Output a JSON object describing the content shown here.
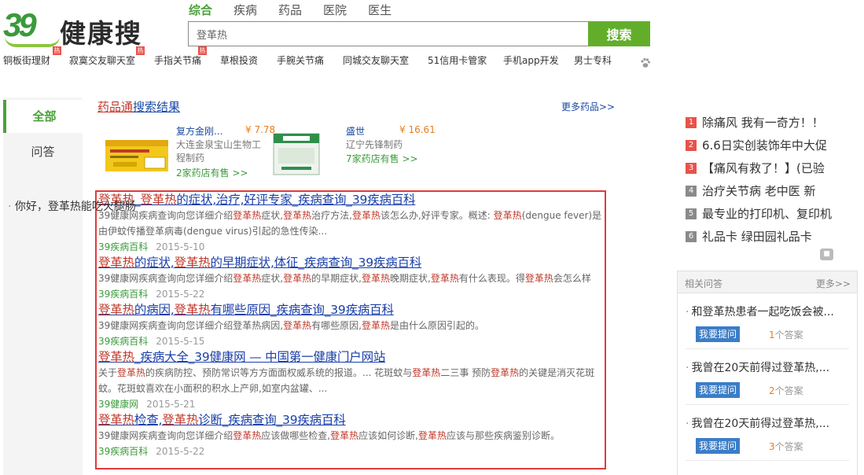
{
  "header": {
    "logo_number": "39",
    "logo_text": "健康搜",
    "tabs": [
      "综合",
      "疾病",
      "药品",
      "医院",
      "医生"
    ],
    "search_value": "登革热",
    "search_button": "搜索",
    "hotlinks": [
      "铜板街理财",
      "寂寞交友聊天室",
      "手指关节痛",
      "草根投资",
      "手腕关节痛",
      "同城交友聊天室",
      "51信用卡管家",
      "手机app开发",
      "男士专科"
    ],
    "hot_badge": "热"
  },
  "leftnav": {
    "items": [
      "全部",
      "问答"
    ]
  },
  "drugs": {
    "title_brand": "药品通",
    "title_rest": "搜索结果",
    "more": "更多药品>>",
    "cards": [
      {
        "name": "复方金刚...",
        "price": "¥ 7.78",
        "maker_line1": "大连金泉宝山生物工",
        "maker_line2": "程制药",
        "stores": "2家药店有售 >>"
      },
      {
        "name": "盛世",
        "price": "¥ 16.61",
        "maker_line1": "辽宁先锋制药",
        "maker_line2": "",
        "stores": "7家药店有售 >>"
      }
    ]
  },
  "results": [
    {
      "title": [
        "登革热",
        "_",
        "登革热",
        "的症状,治疗,好评专家_疾病查询_39疾病百科"
      ],
      "snippet_lines": [
        [
          "39健康网疾病查询向您详细介绍",
          "登革热",
          "症状,",
          "登革热",
          "治疗方法,",
          "登革热",
          "该怎么办,好评专家。概述: ",
          "登革热",
          "(dengue fever)是"
        ],
        [
          "由伊蚊传播登革病毒(dengue virus)引起的急性传染..."
        ]
      ],
      "source": "39疾病百科",
      "date": "2015-5-10"
    },
    {
      "title": [
        "登革热",
        "的症状,",
        "登革热",
        "的早期症状,体征_疾病查询_39疾病百科"
      ],
      "snippet_lines": [
        [
          "39健康网疾病查询向您详细介绍",
          "登革热",
          "症状,",
          "登革热",
          "的早期症状,",
          "登革热",
          "晚期症状,",
          "登革热",
          "有什么表现。得",
          "登革热",
          "会怎么样"
        ]
      ],
      "source": "39疾病百科",
      "date": "2015-5-22"
    },
    {
      "title": [
        "登革热",
        "的病因,",
        "登革热",
        "有哪些原因_疾病查询_39疾病百科"
      ],
      "snippet_lines": [
        [
          "39健康网疾病查询向您详细介绍登革热病因,",
          "登革热",
          "有哪些原因,",
          "登革热",
          "是由什么原因引起的。"
        ]
      ],
      "source": "39疾病百科",
      "date": "2015-5-15"
    },
    {
      "title": [
        "登革热",
        "_疾病大全_39健康网 — 中国第一健康门户网站"
      ],
      "snippet_lines": [
        [
          "关于",
          "登革热",
          "的疾病防控、预防常识等方方面面权威系统的报道。... 花斑蚊与",
          "登革热",
          "二三事 预防",
          "登革热",
          "的关键是消灭花斑"
        ],
        [
          "蚊。花斑蚊喜欢在小面积的积水上产卵,如室内盆罐、..."
        ]
      ],
      "source": "39健康网",
      "date": "2015-5-21"
    },
    {
      "title": [
        "登革热",
        "检查,",
        "登革热",
        "诊断_疾病查询_39疾病百科"
      ],
      "snippet_lines": [
        [
          "39健康网疾病查询向您详细介绍",
          "登革热",
          "应该做哪些检查,",
          "登革热",
          "应该如何诊断,",
          "登革热",
          "应该与那些疾病鉴别诊断。"
        ]
      ],
      "source": "39疾病百科",
      "date": "2015-5-22"
    }
  ],
  "ranking": [
    {
      "num": "1",
      "text": "除痛风 我有一奇方！！"
    },
    {
      "num": "2",
      "text": "6.6日实创装饰年中大促"
    },
    {
      "num": "3",
      "text": "【痛风有救了！】(已验"
    },
    {
      "num": "4",
      "text": "治疗关节病 老中医 新"
    },
    {
      "num": "5",
      "text": "最专业的打印机、复印机"
    },
    {
      "num": "6",
      "text": "礼品卡 绿田园礼品卡"
    }
  ],
  "qa": {
    "title": "相关问答",
    "more": "更多>>",
    "ask_label": "我要提问",
    "answer_suffix": "个答案",
    "items": [
      {
        "q": "和登革热患者一起吃饭会被...",
        "count": "1"
      },
      {
        "q": "我曾在20天前得过登革热,...",
        "count": "2"
      },
      {
        "q": "我曾在20天前得过登革热,...",
        "count": "3"
      }
    ],
    "partial": "你好，登革热能吃火腿肠"
  },
  "colors": {
    "accent_green": "#62ae2a",
    "link_blue": "#1a3fa8",
    "keyword_red": "#c0392b",
    "frame_red": "#e23a3a"
  }
}
